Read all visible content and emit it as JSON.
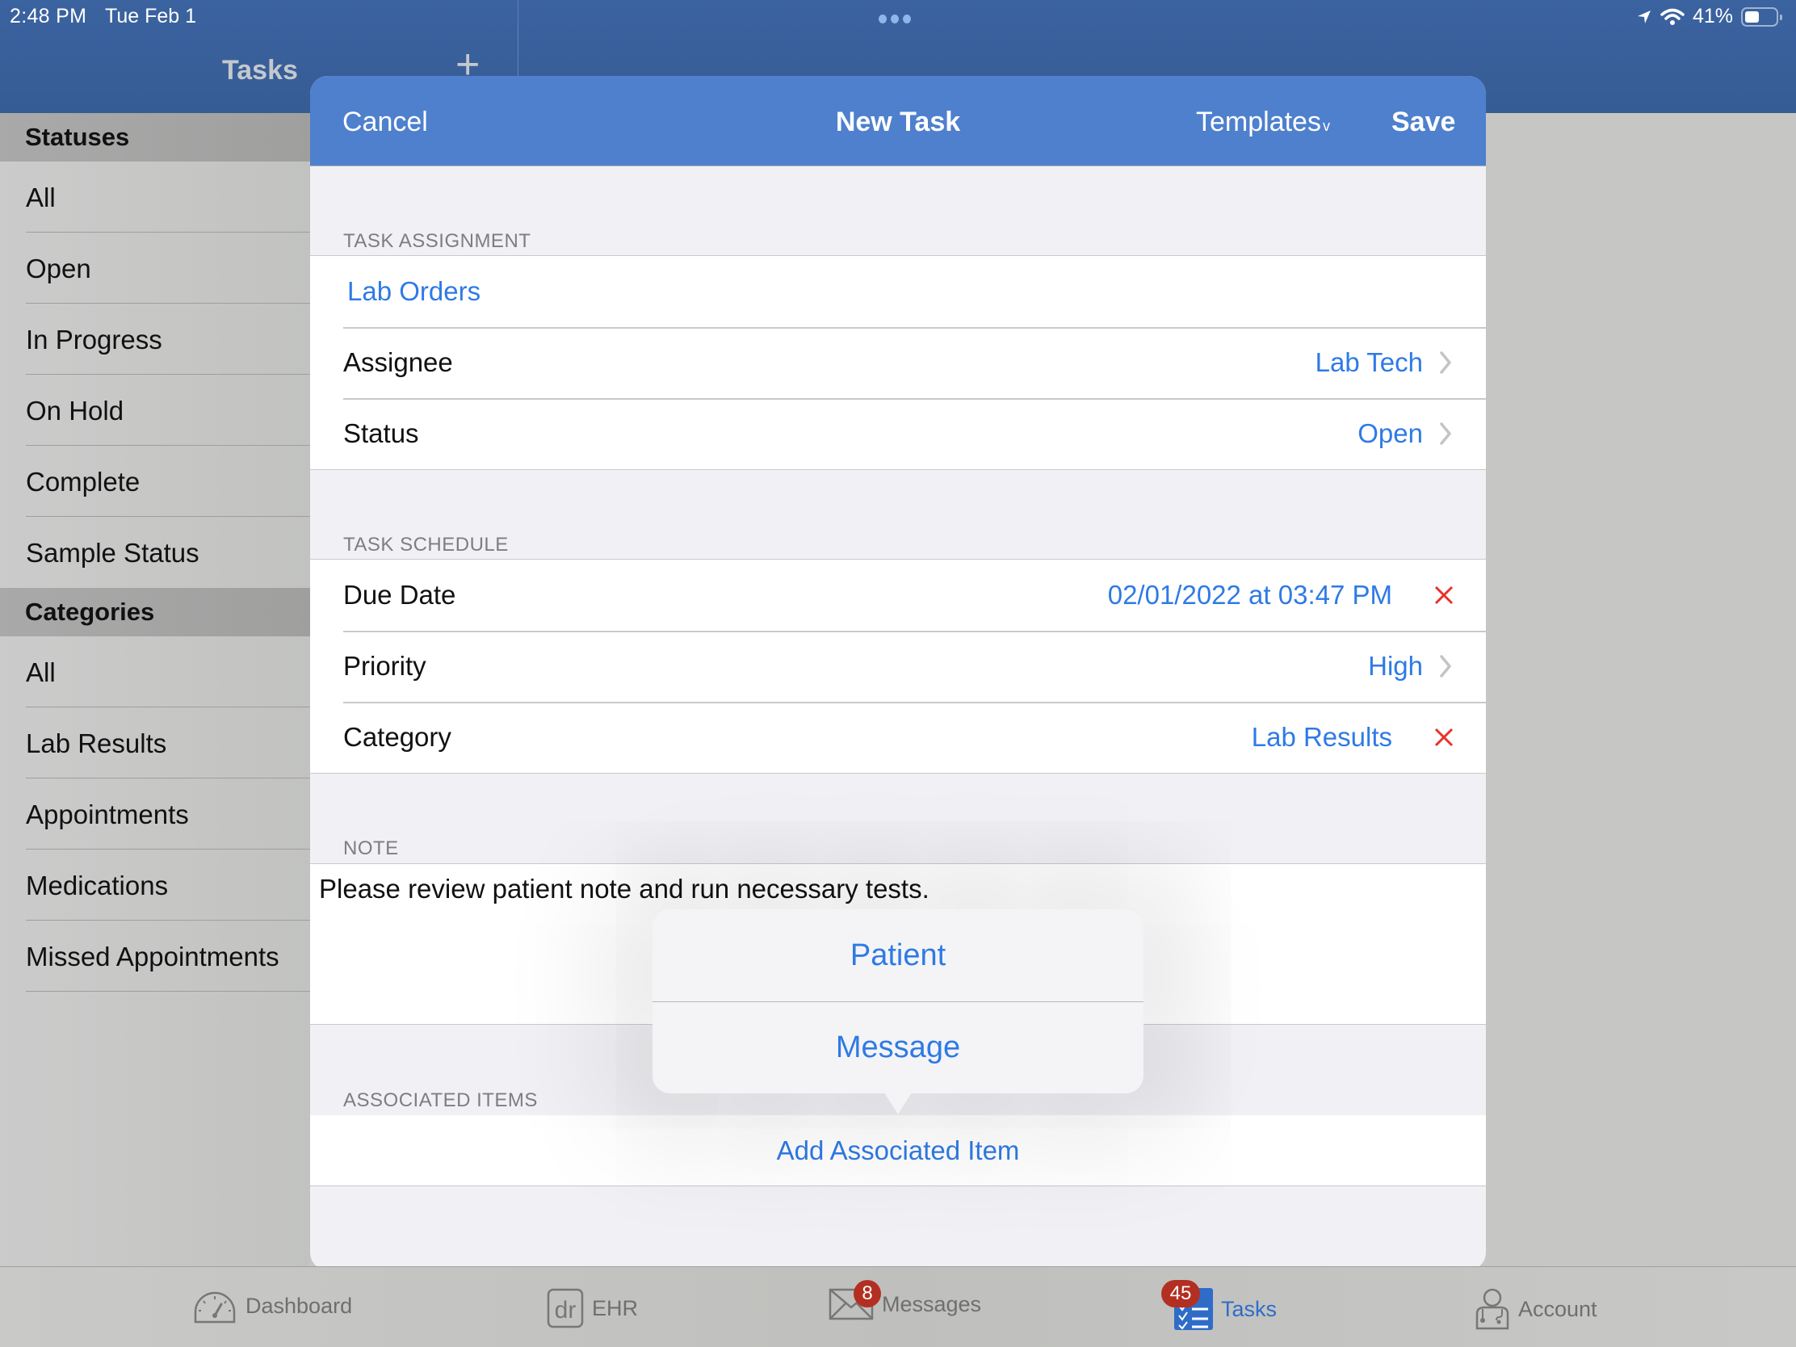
{
  "status_bar": {
    "time": "2:48 PM",
    "date": "Tue Feb 1",
    "battery": "41%",
    "icons": [
      "location-arrow-icon",
      "wifi-icon",
      "battery-icon"
    ]
  },
  "nav": {
    "title": "Tasks",
    "add_label": "+"
  },
  "sidebar": {
    "statuses_header": "Statuses",
    "statuses": [
      "All",
      "Open",
      "In Progress",
      "On Hold",
      "Complete",
      "Sample Status"
    ],
    "categories_header": "Categories",
    "categories": [
      "All",
      "Lab Results",
      "Appointments",
      "Medications",
      "Missed Appointments"
    ]
  },
  "modal": {
    "cancel": "Cancel",
    "title": "New Task",
    "templates": "Templates",
    "templates_caret": "v",
    "save": "Save",
    "task_assignment_label": "TASK ASSIGNMENT",
    "assignment_link": "Lab Orders",
    "assignee_label": "Assignee",
    "assignee_value": "Lab Tech",
    "status_label": "Status",
    "status_value": "Open",
    "task_schedule_label": "TASK SCHEDULE",
    "due_date_label": "Due Date",
    "due_date_value": "02/01/2022 at 03:47 PM",
    "priority_label": "Priority",
    "priority_value": "High",
    "category_label": "Category",
    "category_value": "Lab Results",
    "note_label": "NOTE",
    "note_text": "Please review patient note and run necessary tests.",
    "associated_items_label": "ASSOCIATED ITEMS",
    "add_associated_item": "Add Associated Item"
  },
  "popover": {
    "items": [
      "Patient",
      "Message"
    ]
  },
  "tabbar": {
    "tabs": [
      {
        "label": "Dashboard",
        "icon": "speedometer-icon",
        "badge": null,
        "active": false
      },
      {
        "label": "EHR",
        "icon": "dr-icon",
        "icon_text": "dr",
        "badge": null,
        "active": false
      },
      {
        "label": "Messages",
        "icon": "envelope-icon",
        "badge": "8",
        "active": false
      },
      {
        "label": "Tasks",
        "icon": "checklist-icon",
        "badge": "45",
        "active": true
      },
      {
        "label": "Account",
        "icon": "doctor-icon",
        "badge": null,
        "active": false
      }
    ]
  },
  "colors": {
    "nav_blue": "#3b63a0",
    "modal_header_blue": "#4e80cd",
    "link_blue": "#2f7ae5",
    "delete_red": "#e8322b",
    "badge_red": "#b32f22"
  }
}
